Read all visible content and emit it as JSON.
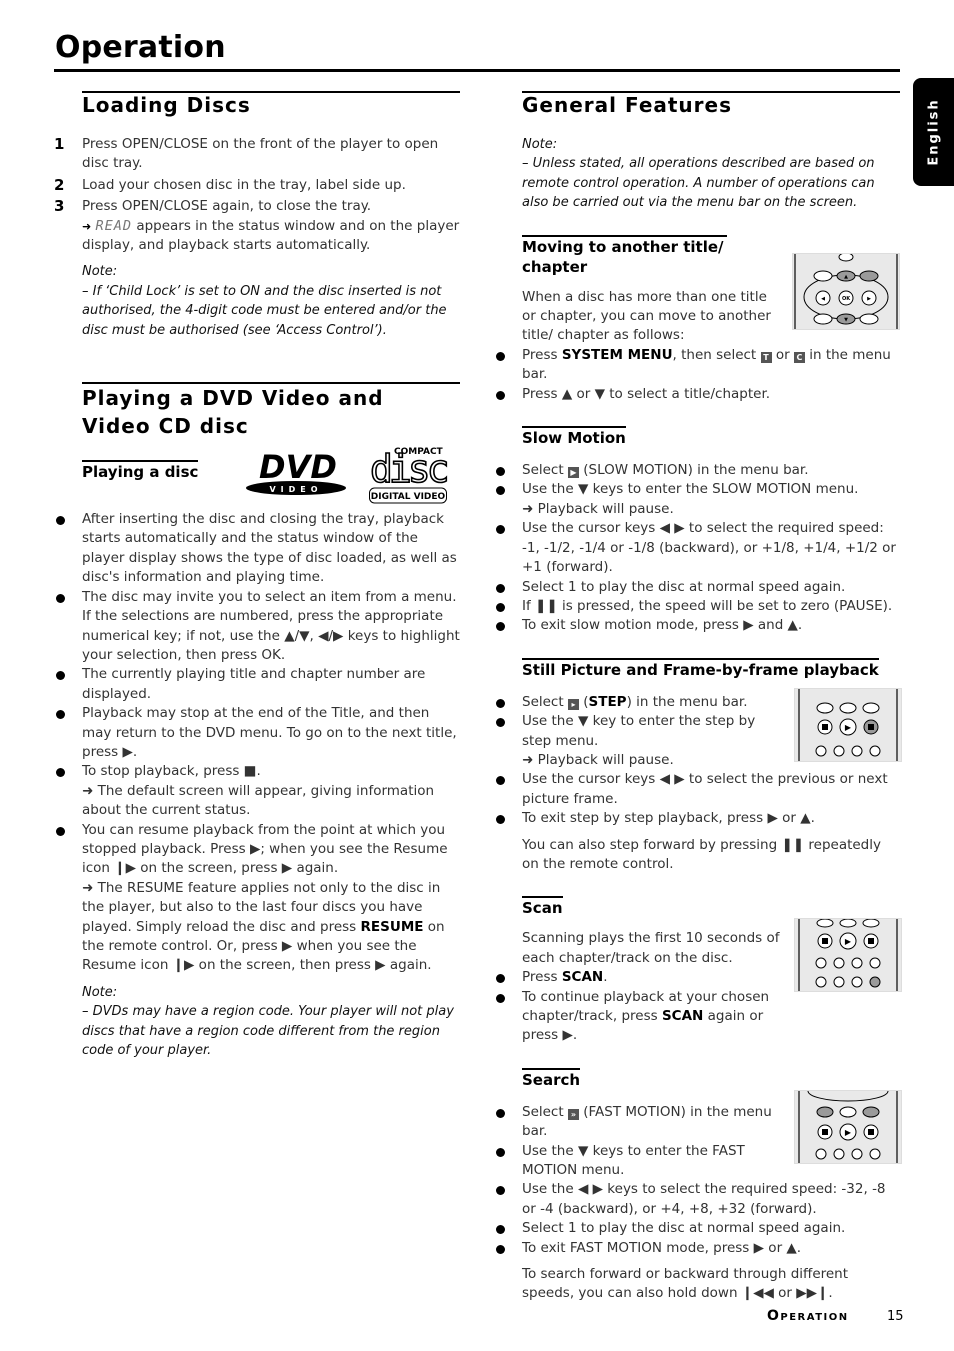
{
  "page": {
    "title": "Operation",
    "language_tab": "English",
    "footer_section": "Operation",
    "page_number": "15"
  },
  "loading_discs": {
    "heading": "Loading Discs",
    "steps": [
      {
        "num": "1",
        "text": "Press OPEN/CLOSE on the front of the player to open disc tray."
      },
      {
        "num": "2",
        "text": "Load your chosen disc in the tray, label side up."
      },
      {
        "num": "3",
        "text": "Press OPEN/CLOSE again, to close the tray."
      }
    ],
    "step3_result_lcd": "READ",
    "step3_result_text": " appears in the status window and on the player display, and playback starts automatically.",
    "note_label": "Note:",
    "note_text": "–  If ‘Child Lock’ is set to ON and the disc inserted is not authorised, the 4-digit code must be entered and/or the disc must be authorised (see ‘Access Control’)."
  },
  "playing_dvd": {
    "heading": "Playing a DVD Video and Video CD disc",
    "subheading": "Playing a disc",
    "logos": {
      "dvd_text": "DVD",
      "dvd_sub": "VIDEO",
      "cd_top": "COMPACT",
      "cd_mid": "disc",
      "cd_bottom": "DIGITAL VIDEO"
    },
    "bullets": [
      "After inserting the disc and closing the tray, playback starts automatically and the status window of the player display shows the type of disc loaded, as well as disc's information and playing time.",
      "The disc may invite you to select an item from a menu. If the selections are numbered, press the appropriate numerical key; if not, use the ▲/▼, ◀/▶ keys to highlight your selection, then press OK.",
      "The currently playing title and chapter number are displayed.",
      "Playback may stop at the end of the Title, and then may return to the DVD menu. To go on to the next title, press ▶."
    ],
    "stop_text": "To stop playback, press ■.",
    "stop_result": "➜ The default screen will appear, giving information about the current status.",
    "resume_text": "You can resume playback from the point at which you stopped playback. Press ▶; when you see the Resume icon ❙▶ on the screen, press ▶ again.",
    "resume_result_a": "➜ The RESUME feature applies not only to the disc in the player, but also to the last four discs you have played. Simply reload the disc and press ",
    "resume_result_bold": "RESUME",
    "resume_result_b": " on the remote control. Or, press ▶ when you see the Resume icon ❙▶ on the screen, then press ▶ again.",
    "note_label": "Note:",
    "note_text": "–  DVDs may have a region code. Your player will not play discs that have a region code different from the region code of your player."
  },
  "general_features": {
    "heading": "General Features",
    "note_label": "Note:",
    "note_text": "–  Unless stated, all operations described are based on remote control operation. A number of operations can also be carried out via the menu bar on the screen."
  },
  "moving_title": {
    "heading_line1": "Moving to another title/",
    "heading_line2": "chapter",
    "intro": "When a disc has more than one title or chapter, you can move to another title/ chapter as follows:",
    "b1_pre": "Press ",
    "b1_bold": "SYSTEM MENU",
    "b1_mid": ", then select ",
    "icon_t": "T",
    "b1_or": " or ",
    "icon_c": "C",
    "b1_post": " in the menu bar.",
    "b2": "Press ▲ or ▼ to select a title/chapter."
  },
  "slow_motion": {
    "heading": "Slow Motion",
    "b1_pre": "Select ",
    "b1_post": " (SLOW MOTION) in the menu bar.",
    "b2": "Use the ▼ keys to enter the SLOW MOTION menu.",
    "b2_result": "➜ Playback will pause.",
    "b3": "Use the cursor keys ◀ ▶ to select the required speed: -1, -1/2, -1/4 or -1/8 (backward), or +1/8, +1/4, +1/2 or +1 (forward).",
    "b4": "Select 1 to play the disc at normal speed again.",
    "b5": "If ❚❚ is pressed, the speed will be set to zero (PAUSE).",
    "b6": "To exit slow motion mode, press ▶ and ▲."
  },
  "still_picture": {
    "heading": "Still Picture and Frame-by-frame playback",
    "b1_pre": "Select ",
    "b1_bold": "STEP",
    "b1_post": ") in the menu bar.",
    "b1_paren": " (",
    "b2": "Use the ▼ key to enter the step by step menu.",
    "b2_result": "➜ Playback will pause.",
    "b3": "Use the cursor keys ◀ ▶ to select the previous or next picture frame.",
    "b4": "To exit step by step playback, press ▶ or ▲.",
    "footer": "You can also step forward by pressing ❚❚ repeatedly on the remote control."
  },
  "scan": {
    "heading": "Scan",
    "intro": "Scanning plays the first 10 seconds of each chapter/track on the disc.",
    "b1_pre": "Press ",
    "b1_bold": "SCAN",
    "b1_post": ".",
    "b2_pre": "To continue playback at your chosen chapter/track, press ",
    "b2_bold": "SCAN",
    "b2_post": " again or press ▶."
  },
  "search": {
    "heading": "Search",
    "b1_pre": "Select ",
    "b1_post": " (FAST MOTION) in the menu bar.",
    "b2": "Use the ▼ keys to enter the FAST MOTION menu.",
    "b3": "Use the ◀ ▶ keys to select the required speed: -32, -8 or -4 (backward), or +4, +8, +32 (forward).",
    "b4": "Select 1 to play the disc at normal speed again.",
    "b5": "To exit FAST MOTION mode, press ▶ or ▲.",
    "footer": "To search forward or backward through different speeds, you can also hold down ❙◀◀ or ▶▶❙."
  },
  "remote_labels": {
    "ok": "OK",
    "highlight_color": "#9a9a9a",
    "panel_color": "#e9e9e9"
  }
}
